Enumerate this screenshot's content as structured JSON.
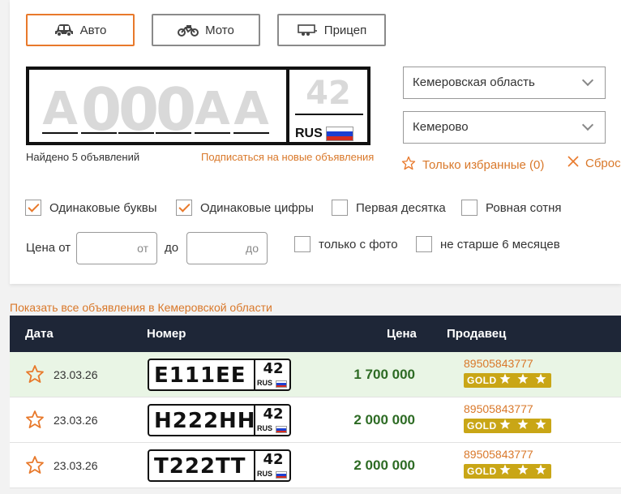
{
  "vehicle_types": [
    {
      "label": "Авто",
      "icon": "car-icon",
      "active": true
    },
    {
      "label": "Мото",
      "icon": "motorcycle-icon",
      "active": false
    },
    {
      "label": "Прицеп",
      "icon": "trailer-icon",
      "active": false
    }
  ],
  "plate_input": {
    "placeholder_chars": [
      "А",
      "0",
      "0",
      "0",
      "А",
      "А"
    ],
    "region_placeholder": "42",
    "country": "RUS"
  },
  "results": {
    "found_text": "Найдено 5 объявлений",
    "subscribe_link": "Подписаться на новые объявления"
  },
  "region_select": {
    "value": "Кемеровская область"
  },
  "city_select": {
    "value": "Кемерово"
  },
  "favorites": {
    "label": "Только избранные (0)"
  },
  "reset": {
    "label": "Сбросить"
  },
  "filters": {
    "same_letters": {
      "label": "Одинаковые буквы",
      "checked": true
    },
    "same_digits": {
      "label": "Одинаковые цифры",
      "checked": true
    },
    "first_ten": {
      "label": "Первая десятка",
      "checked": false
    },
    "round_hundred": {
      "label": "Ровная сотня",
      "checked": false
    },
    "with_photo": {
      "label": "только с фото",
      "checked": false
    },
    "not_older": {
      "label": "не старше 6 месяцев",
      "checked": false
    }
  },
  "price": {
    "label_from": "Цена от",
    "placeholder_from": "от",
    "label_to": "до",
    "placeholder_to": "до"
  },
  "show_all_link": "Показать все объявления в Кемеровской области",
  "table": {
    "headers": {
      "date": "Дата",
      "number": "Номер",
      "price": "Цена",
      "seller": "Продавец"
    },
    "rows": [
      {
        "date": "23.03.26",
        "number": "Е111ЕЕ",
        "region": "42",
        "country": "RUS",
        "price": "1 700 000",
        "phone": "89505843777",
        "badge": "GOLD"
      },
      {
        "date": "23.03.26",
        "number": "Н222НН",
        "region": "42",
        "country": "RUS",
        "price": "2 000 000",
        "phone": "89505843777",
        "badge": "GOLD"
      },
      {
        "date": "23.03.26",
        "number": "Т222ТТ",
        "region": "42",
        "country": "RUS",
        "price": "2 000 000",
        "phone": "89505843777",
        "badge": "GOLD"
      }
    ]
  },
  "colors": {
    "accent": "#e8792b",
    "header_bg": "#1e2637",
    "price_green": "#2d6b24",
    "gold": "#c9a616",
    "highlight_row": "#e9f5e5"
  }
}
